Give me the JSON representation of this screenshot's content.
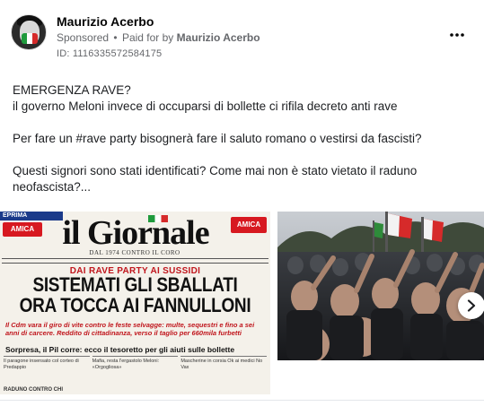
{
  "post": {
    "author": "Maurizio Acerbo",
    "sponsored_label": "Sponsored",
    "separator": "•",
    "paid_for_prefix": "Paid for by",
    "paid_for_by": "Maurizio Acerbo",
    "id_label": "ID: 1116335572584175",
    "more_icon": "more-horizontal-icon",
    "more_glyph": "•••",
    "text_lines": [
      "EMERGENZA RAVE?",
      "il governo Meloni invece di occuparsi di bollette ci rifila decreto anti rave",
      "",
      "Per fare un #rave party bisognerà fare il saluto romano o vestirsi da fascisti?",
      "",
      "Questi signori sono stati identificati? Come mai non è stato vietato il raduno",
      "neofascista?..."
    ]
  },
  "newspaper": {
    "banner": "EPRIMA RASSEGNA",
    "amica_left": "AMICA",
    "amica_right": "AMICA",
    "masthead": "il Giornale",
    "since": "DAL 1974 CONTRO IL CORO",
    "kicker": "DAI RAVE PARTY AI SUSSIDI",
    "headline_1": "SISTEMATI GLI SBALLATI",
    "headline_2": "ORA TOCCA AI FANNULLONI",
    "subhead": "Il Cdm vara il giro di vite contro le feste selvagge: multe, sequestri e fino a sei anni di carcere. Reddito di cittadinanza, verso il taglio per 660mila furbetti",
    "subhead_2": "Sorpresa, il Pil corre: ecco il tesoretto per gli aiuti sulle bollette",
    "columns": [
      "Il paragone insensato col corteo di Predappio",
      "Mafia, resta l'ergastolo Meloni: «Orgogliosa»",
      "Mascherine in corsia Ok ai medici No Vax"
    ],
    "footer": "RADUNO CONTRO CHI"
  },
  "media": {
    "next_icon": "chevron-right-icon"
  },
  "colors": {
    "text_primary": "#1c1e21",
    "text_secondary": "#65676b",
    "newspaper_red": "#c0151c",
    "amica_red": "#d71920"
  }
}
